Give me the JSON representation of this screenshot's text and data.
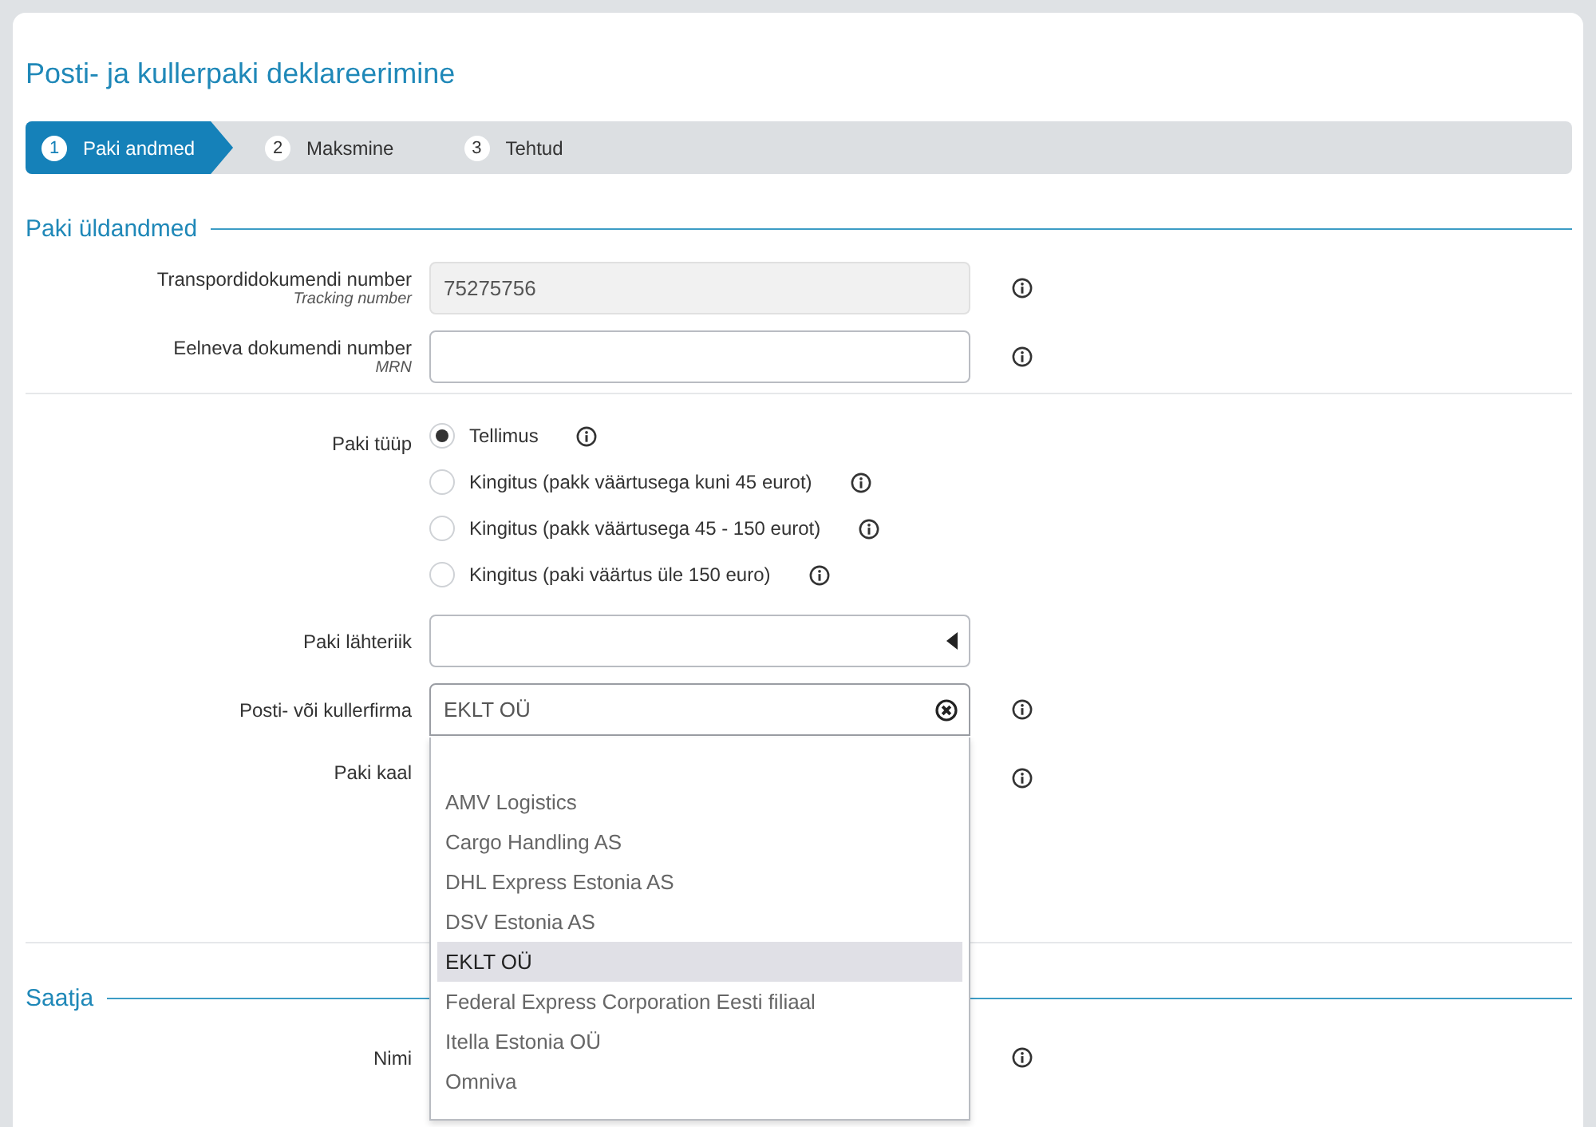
{
  "title": "Posti- ja kullerpaki deklareerimine",
  "steps": [
    {
      "number": "1",
      "label": "Paki andmed",
      "selected": true
    },
    {
      "number": "2",
      "label": "Maksmine",
      "selected": false
    },
    {
      "number": "3",
      "label": "Tehtud",
      "selected": false
    }
  ],
  "general": {
    "heading": "Paki üldandmed",
    "tracking": {
      "label": "Transpordidokumendi number",
      "sublabel": "Tracking number",
      "value": "75275756",
      "disabled": true
    },
    "mrn": {
      "label": "Eelneva dokumendi number",
      "sublabel": "MRN"
    },
    "type": {
      "label": "Paki tüüp",
      "options": [
        {
          "label": "Tellimus",
          "selected": true
        },
        {
          "label": "Kingitus (pakk väärtusega kuni 45 eurot)",
          "selected": false
        },
        {
          "label": "Kingitus (pakk väärtusega 45 - 150 eurot)",
          "selected": false
        },
        {
          "label": "Kingitus (paki väärtus üle 150 euro)",
          "selected": false
        }
      ]
    },
    "origin": {
      "label": "Paki lähteriik"
    },
    "carrier": {
      "label": "Posti- või kullerfirma",
      "value": "EKLT OÜ",
      "expanded": true,
      "options": [
        {
          "label": "AMV Logistics",
          "selected": false
        },
        {
          "label": "Cargo Handling AS",
          "selected": false
        },
        {
          "label": "DHL Express Estonia AS",
          "selected": false
        },
        {
          "label": "DSV Estonia AS",
          "selected": false
        },
        {
          "label": "EKLT OÜ",
          "selected": true
        },
        {
          "label": "Federal Express Corporation Eesti filiaal",
          "selected": false
        },
        {
          "label": "Itella Estonia OÜ",
          "selected": false
        },
        {
          "label": "Omniva",
          "selected": false
        }
      ]
    },
    "weight": {
      "label": "Paki kaal"
    }
  },
  "sender": {
    "heading": "Saatja",
    "name": {
      "label": "Nimi"
    }
  }
}
